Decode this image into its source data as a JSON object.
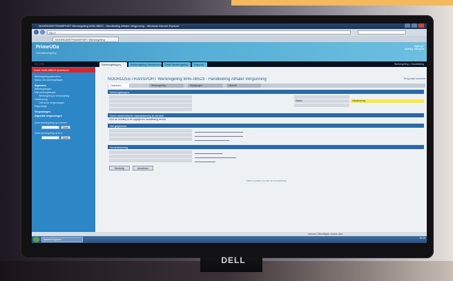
{
  "window": {
    "title": "NOORDZEETRANSPORT Werkregeling W45-08523 - Handleiding Afhaler Vergunning - Windows Internet Explorer",
    "address": "http://",
    "tab": "NOORDZEETRANSPORT Werkregeling"
  },
  "app": {
    "logo": "PrimeUDa",
    "subtitle": "Gebruikersregeling",
    "user_line1": "Ingelogd:",
    "user_line2": "Afdeling Transport",
    "lang": "NL | EN"
  },
  "menu": {
    "tabs": [
      {
        "label": "Werkregelingen"
      },
      {
        "label": "Werkregeling Handhaving"
      },
      {
        "label": "Draft Werkregeling"
      },
      {
        "label": "Rapport"
      }
    ],
    "crumb": "Werkregeling > Handleiding"
  },
  "sidebar": {
    "header": "Zoek: W45-08523 nederland",
    "items": [
      {
        "label": "Werkregeling aanmaken"
      },
      {
        "label": "Status van werkregelingen"
      },
      {
        "label": "Algemeen",
        "bold": true
      },
      {
        "label": "Werkregelingen"
      },
      {
        "label": "Mijn werkregelingen"
      },
      {
        "label": "Werkregeling in behandeling"
      },
      {
        "label": "Handhaving"
      },
      {
        "label": "Overzicht vergunningen"
      },
      {
        "label": "Rapportage"
      },
      {
        "label": "Vergunningen",
        "bold": true
      },
      {
        "label": "Afgeleide vergunningen",
        "bold": true
      },
      {
        "label": "Zoek werkregeling op nummer"
      },
      {
        "label": "Zoek werkregeling op B.V."
      }
    ],
    "search_button": "Zoek"
  },
  "main": {
    "title": "NOORDZEETRANSPORT Werkregeling W45-08523 - Handleiding Afhaler Vergunning",
    "title_link": "Terug naar overzicht",
    "subtabs": [
      "Overzicht",
      "Werkregeling",
      "Wijzigingen",
      "Historie"
    ],
    "sections": [
      {
        "title": "Werkregelingen"
      },
      {
        "title": "Geen elektronische handtekening te zenden"
      },
      {
        "title": "Uw gegevens"
      },
      {
        "title": "Ondertekening"
      }
    ],
    "note": "Voor de zending is de opgegeven handleiding vereist.",
    "status_label": "Status",
    "status_value": "Handhaving",
    "buttons": [
      "Bevestig",
      "Annuleren"
    ],
    "footer": "Neem contact op met de servicedesk"
  },
  "status": {
    "zone": "Internet | Beveiligde modus: Aan"
  },
  "taskbar": {
    "items": [
      "Internet Explorer"
    ],
    "time": "10:24"
  }
}
